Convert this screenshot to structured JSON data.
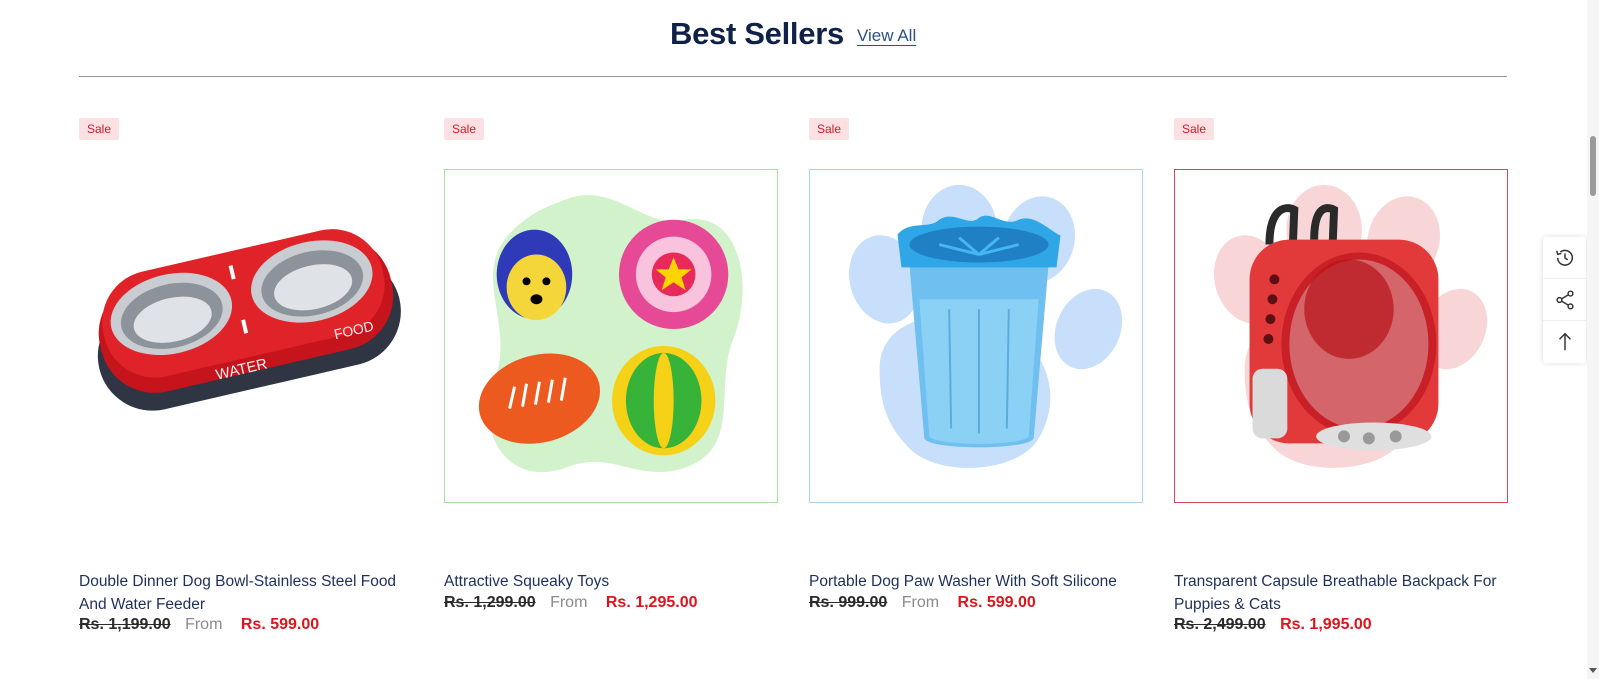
{
  "section": {
    "title": "Best Sellers",
    "view_all": "View All"
  },
  "products": [
    {
      "badge": "Sale",
      "name": "Double Dinner Dog Bowl-Stainless Steel Food And Water Feeder",
      "old_price": "Rs. 1,199.00",
      "from": "From",
      "sale_price": "Rs. 599.00",
      "image_labels": {
        "water": "WATER",
        "food": "FOOD"
      }
    },
    {
      "badge": "Sale",
      "name": "Attractive Squeaky Toys",
      "old_price": "Rs. 1,299.00",
      "from": "From",
      "sale_price": "Rs. 1,295.00",
      "border_color": "#a8e0a0"
    },
    {
      "badge": "Sale",
      "name": "Portable Dog Paw Washer With Soft Silicone",
      "old_price": "Rs. 999.00",
      "from": "From",
      "sale_price": "Rs. 599.00",
      "border_color": "#a9d3ec"
    },
    {
      "badge": "Sale",
      "name": "Transparent Capsule Breathable Backpack For Puppies & Cats",
      "old_price": "Rs. 2,499.00",
      "sale_price": "Rs. 1,995.00",
      "border_color": "#d64a55"
    }
  ],
  "side_tools": [
    "history-icon",
    "share-icon",
    "arrow-up-icon"
  ],
  "colors": {
    "sale_red": "#e0131d",
    "title_navy": "#0f2147",
    "badge_bg": "#fde0e2"
  }
}
